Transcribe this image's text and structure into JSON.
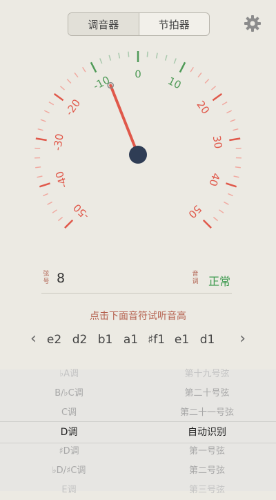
{
  "tabs": {
    "tuner": "调音器",
    "metronome": "节拍器"
  },
  "gauge": {
    "labels_left": [
      "-10",
      "-20",
      "-30",
      "-40",
      "-50"
    ],
    "labels_right": [
      "10",
      "20",
      "30",
      "40",
      "50"
    ],
    "label_zero": "0",
    "needle_cents": -8,
    "colors": {
      "green": "#4f9a57",
      "red": "#e0584a",
      "needle": "#e0584a",
      "hub": "#2f3d55"
    }
  },
  "info": {
    "string_label": "弦号",
    "string_value": "8",
    "status_label": "音调",
    "status_value": "正常"
  },
  "hint": "点击下面音符试听音高",
  "notes": {
    "left_arrow": "‹",
    "right_arrow": "›",
    "items": [
      "e2",
      "d2",
      "b1",
      "a1",
      "♯f1",
      "e1",
      "d1"
    ]
  },
  "picker": {
    "left": [
      "♭A调",
      "B/♭C调",
      "C调",
      "D调",
      "♯D调",
      "♭D/♯C调",
      "E调"
    ],
    "right": [
      "第十九号弦",
      "第二十号弦",
      "第二十一号弦",
      "自动识别",
      "第一号弦",
      "第二号弦",
      "第三号弦"
    ],
    "selected_index": 3
  }
}
